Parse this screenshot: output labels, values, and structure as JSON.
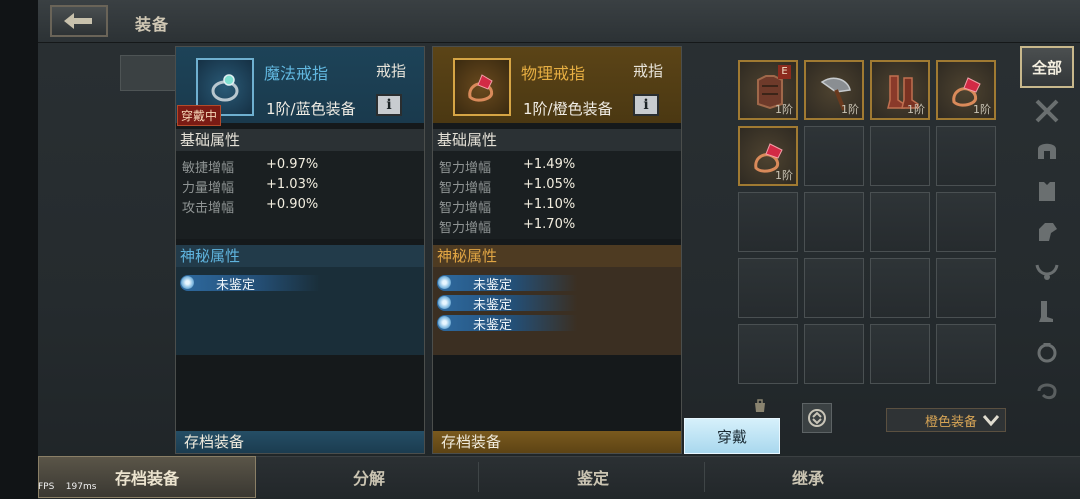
{
  "header": {
    "title": "装备"
  },
  "left_item": {
    "name": "魔法戒指",
    "type": "戒指",
    "grade": "1阶/蓝色装备",
    "wearing_tag": "穿戴中",
    "info": "i",
    "base_section": "基础属性",
    "stats": [
      {
        "label": "敏捷增幅",
        "value": "+0.97%"
      },
      {
        "label": "力量增幅",
        "value": "+1.03%"
      },
      {
        "label": "攻击增幅",
        "value": "+0.90%"
      }
    ],
    "mystic_section": "神秘属性",
    "mystic": [
      "未鉴定"
    ],
    "footer": "存档装备"
  },
  "right_item": {
    "name": "物理戒指",
    "type": "戒指",
    "grade": "1阶/橙色装备",
    "info": "i",
    "base_section": "基础属性",
    "stats": [
      {
        "label": "智力增幅",
        "value": "+1.49%"
      },
      {
        "label": "智力增幅",
        "value": "+1.05%"
      },
      {
        "label": "智力增幅",
        "value": "+1.10%"
      },
      {
        "label": "智力增幅",
        "value": "+1.70%"
      }
    ],
    "mystic_section": "神秘属性",
    "mystic": [
      "未鉴定",
      "未鉴定",
      "未鉴定"
    ],
    "footer": "存档装备"
  },
  "equip_button": "穿戴",
  "inventory": {
    "slots": [
      {
        "icon": "armor-icon",
        "tier": "1阶",
        "badge": "E"
      },
      {
        "icon": "axe-icon",
        "tier": "1阶"
      },
      {
        "icon": "boots-icon",
        "tier": "1阶"
      },
      {
        "icon": "ring-icon",
        "tier": "1阶"
      },
      {
        "icon": "ring-icon",
        "tier": "1阶"
      }
    ],
    "filter": "橙色装备"
  },
  "side_tabs": {
    "all": "全部",
    "icons": [
      "crossed-swords-icon",
      "helmet-icon",
      "chest-armor-icon",
      "gauntlet-icon",
      "necklace-icon",
      "boots-icon",
      "ring-icon",
      "amulet-icon"
    ]
  },
  "bottom_tabs": [
    "存档装备",
    "分解",
    "鉴定",
    "继承"
  ],
  "debug": {
    "fps": "FPS",
    "ms": "197ms"
  },
  "colors": {
    "blue_accent": "#62b8e0",
    "orange_accent": "#e6ae42",
    "equip_button": "#bfe4f5"
  }
}
